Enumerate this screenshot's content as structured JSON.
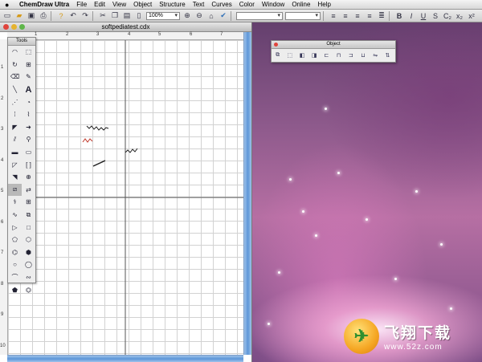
{
  "menubar": {
    "app_name": "ChemDraw Ultra",
    "items": [
      "File",
      "Edit",
      "View",
      "Object",
      "Structure",
      "Text",
      "Curves",
      "Color",
      "Window",
      "Online",
      "Help"
    ]
  },
  "toolbar": {
    "zoom_value": "100%"
  },
  "document": {
    "title": "softpediatest.cdx",
    "ruler_top": [
      "1",
      "2",
      "3",
      "4",
      "5",
      "6",
      "7"
    ],
    "ruler_left": [
      "1",
      "2",
      "3",
      "4",
      "5",
      "6",
      "7",
      "8",
      "9",
      "10"
    ]
  },
  "tools_palette": {
    "title": "Tools",
    "text_tool_glyph": "A"
  },
  "object_palette": {
    "title": "Object"
  },
  "watermark": {
    "brand": "飞翔下载",
    "url": "www.52z.com"
  },
  "colors": {
    "scroll_blue": "#5d96d8",
    "close_red": "#e0443c",
    "minimize_yellow": "#e6b32e",
    "zoom_green": "#5fb64a"
  }
}
